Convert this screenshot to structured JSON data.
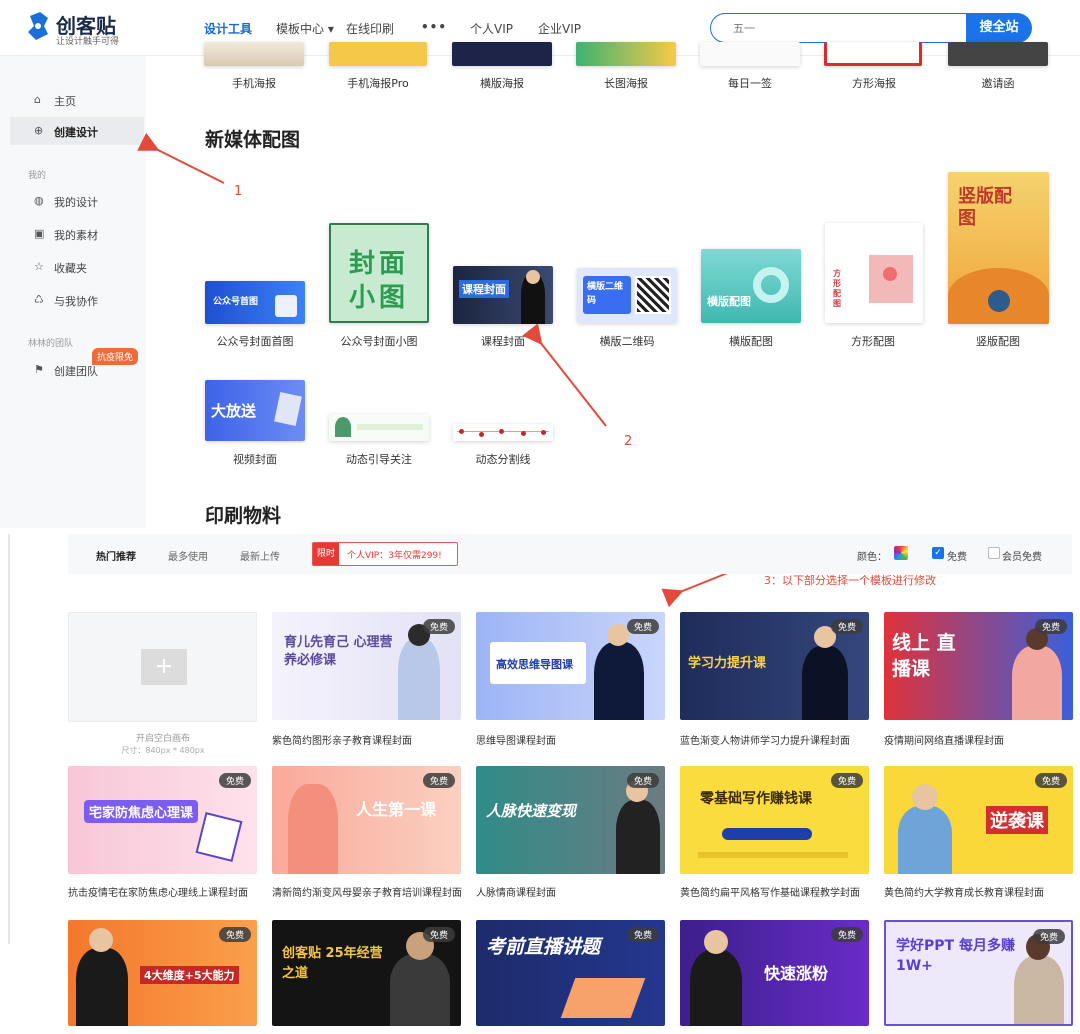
{
  "header": {
    "logo_name": "创客贴",
    "logo_slogan": "让设计触手可得",
    "nav": [
      "设计工具",
      "模板中心 ▾",
      "在线印刷",
      "•••",
      "个人VIP",
      "企业VIP"
    ],
    "search_placeholder": "五一",
    "search_button": "搜全站"
  },
  "sidebar": {
    "items_top": [
      {
        "label": "主页",
        "icon": "home-icon"
      },
      {
        "label": "创建设计",
        "icon": "plus-circle-icon"
      }
    ],
    "section_mine": "我的",
    "items_mine": [
      {
        "label": "我的设计",
        "icon": "palette-icon"
      },
      {
        "label": "我的素材",
        "icon": "image-icon"
      },
      {
        "label": "收藏夹",
        "icon": "star-icon"
      },
      {
        "label": "与我协作",
        "icon": "share-icon"
      }
    ],
    "section_team": "林林的团队",
    "promo_badge": "抗疫限免",
    "team_item": {
      "label": "创建团队",
      "icon": "team-icon"
    }
  },
  "top_row_labels": [
    "手机海报",
    "手机海报Pro",
    "横版海报",
    "长图海报",
    "每日一签",
    "方形海报",
    "邀请函"
  ],
  "section_newmedia": "新媒体配图",
  "newmedia_row1": [
    {
      "label": "公众号封面首图",
      "thumb_text": "公众号首图"
    },
    {
      "label": "公众号封面小图",
      "thumb_text": "封面小图"
    },
    {
      "label": "课程封面",
      "thumb_text": "课程封面"
    },
    {
      "label": "横版二维码",
      "thumb_text": "横版二维码"
    },
    {
      "label": "横版配图",
      "thumb_text": "横版配图"
    },
    {
      "label": "方形配图",
      "thumb_text": "方形配图"
    },
    {
      "label": "竖版配图",
      "thumb_text": "竖版配图"
    }
  ],
  "newmedia_row2": [
    {
      "label": "视频封面",
      "thumb_text": "大放送"
    },
    {
      "label": "动态引导关注"
    },
    {
      "label": "动态分割线"
    }
  ],
  "section_print": "印刷物料",
  "annotations": {
    "n1": "1",
    "n2": "2",
    "n3": "3：以下部分选择一个模板进行修改"
  },
  "filterbar": {
    "tabs": [
      "热门推荐",
      "最多使用",
      "最新上传"
    ],
    "vip_tag": "限时",
    "vip_text": "个人VIP：3年仅需299!",
    "color_label": "颜色：",
    "free_label": "免费",
    "member_free_label": "会员免费",
    "free_checked": true,
    "member_free_checked": false
  },
  "blank_canvas": {
    "title": "开启空白画布",
    "size": "尺寸：840px * 480px"
  },
  "free_badge": "免费",
  "templates": [
    {
      "title": "紫色简约图形亲子教育课程封面",
      "text": "育儿先育己 心理营养必修课"
    },
    {
      "title": "思维导图课程封面",
      "text": "高效思维导图课"
    },
    {
      "title": "蓝色渐变人物讲师学习力提升课程封面",
      "text": "学习力提升课"
    },
    {
      "title": "疫情期间网络直播课程封面",
      "text": "线上 直播课"
    },
    {
      "title": "抗击疫情宅在家防焦虑心理线上课程封面",
      "text": "宅家防焦虑心理课"
    },
    {
      "title": "清新简约渐变风母婴亲子教育培训课程封面",
      "text": "人生第一课"
    },
    {
      "title": "人脉情商课程封面",
      "text": "人脉快速变现"
    },
    {
      "title": "黄色简约扁平风格写作基础课程教学封面",
      "text": "零基础写作赚钱课"
    },
    {
      "title": "黄色简约大学教育成长教育课程封面",
      "text": "逆袭课"
    },
    {
      "text": "4大维度+5大能力"
    },
    {
      "text": "创客贴 25年经营之道"
    },
    {
      "text": "考前直播讲题"
    },
    {
      "text": "快速涨粉"
    },
    {
      "text": "学好PPT 每月多赚1W+"
    }
  ]
}
